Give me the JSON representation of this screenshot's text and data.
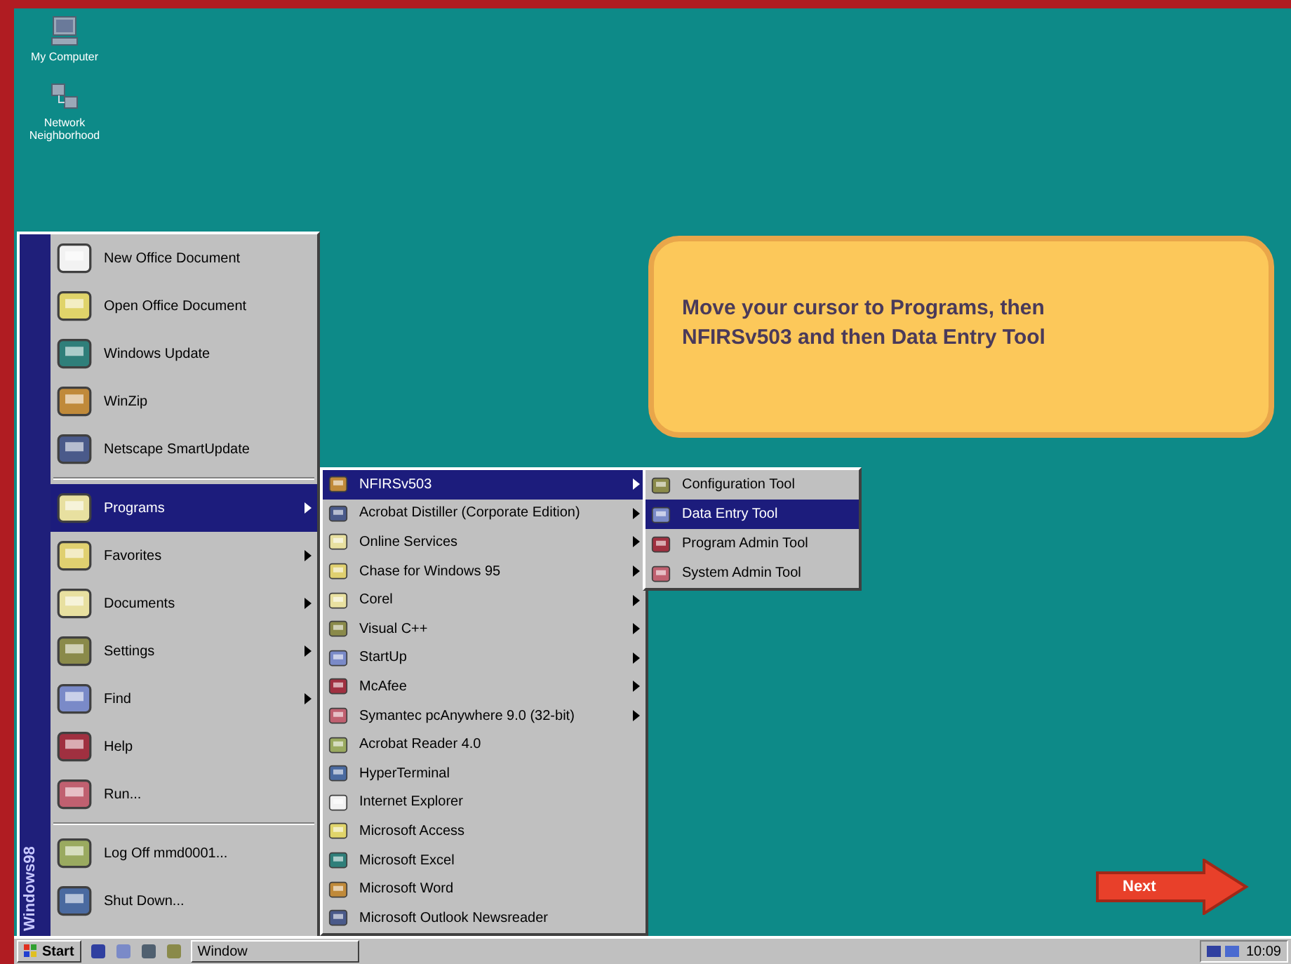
{
  "desktop_icons": [
    {
      "label": "My Computer"
    },
    {
      "label": "Network Neighborhood"
    }
  ],
  "callout": {
    "text": "Move your cursor to Programs, then NFIRSv503 and then Data Entry Tool"
  },
  "next_button": {
    "label": "Next"
  },
  "start_menu": {
    "banner": "Windows98",
    "items": [
      {
        "label": "New Office Document",
        "selected": false,
        "has_submenu": false
      },
      {
        "label": "Open Office Document",
        "selected": false,
        "has_submenu": false
      },
      {
        "label": "Windows Update",
        "selected": false,
        "has_submenu": false
      },
      {
        "label": "WinZip",
        "selected": false,
        "has_submenu": false
      },
      {
        "label": "Netscape SmartUpdate",
        "selected": false,
        "has_submenu": false,
        "separator_after": true
      },
      {
        "label": "Programs",
        "selected": true,
        "has_submenu": true
      },
      {
        "label": "Favorites",
        "selected": false,
        "has_submenu": true
      },
      {
        "label": "Documents",
        "selected": false,
        "has_submenu": true
      },
      {
        "label": "Settings",
        "selected": false,
        "has_submenu": true
      },
      {
        "label": "Find",
        "selected": false,
        "has_submenu": true
      },
      {
        "label": "Help",
        "selected": false,
        "has_submenu": false
      },
      {
        "label": "Run...",
        "selected": false,
        "has_submenu": false,
        "separator_after": true
      },
      {
        "label": "Log Off mmd0001...",
        "selected": false,
        "has_submenu": false
      },
      {
        "label": "Shut Down...",
        "selected": false,
        "has_submenu": false
      }
    ]
  },
  "programs_menu": {
    "items": [
      {
        "label": "NFIRSv503",
        "selected": true,
        "has_submenu": true
      },
      {
        "label": "Acrobat Distiller (Corporate Edition)",
        "selected": false,
        "has_submenu": true
      },
      {
        "label": "Online Services",
        "selected": false,
        "has_submenu": true
      },
      {
        "label": "Chase for Windows 95",
        "selected": false,
        "has_submenu": true
      },
      {
        "label": "Corel",
        "selected": false,
        "has_submenu": true
      },
      {
        "label": "Visual C++",
        "selected": false,
        "has_submenu": true
      },
      {
        "label": "StartUp",
        "selected": false,
        "has_submenu": true
      },
      {
        "label": "McAfee",
        "selected": false,
        "has_submenu": true
      },
      {
        "label": "Symantec pcAnywhere 9.0 (32-bit)",
        "selected": false,
        "has_submenu": true
      },
      {
        "label": "Acrobat Reader 4.0",
        "selected": false,
        "has_submenu": false
      },
      {
        "label": "HyperTerminal",
        "selected": false,
        "has_submenu": false
      },
      {
        "label": "Internet Explorer",
        "selected": false,
        "has_submenu": false
      },
      {
        "label": "Microsoft Access",
        "selected": false,
        "has_submenu": false
      },
      {
        "label": "Microsoft Excel",
        "selected": false,
        "has_submenu": false
      },
      {
        "label": "Microsoft Word",
        "selected": false,
        "has_submenu": false
      },
      {
        "label": "Microsoft Outlook Newsreader",
        "selected": false,
        "has_submenu": false
      }
    ]
  },
  "nfirs_menu": {
    "items": [
      {
        "label": "Configuration Tool",
        "selected": false
      },
      {
        "label": "Data Entry Tool",
        "selected": true
      },
      {
        "label": "Program Admin Tool",
        "selected": false
      },
      {
        "label": "System Admin Tool",
        "selected": false
      }
    ]
  },
  "taskbar": {
    "start_label": "Start",
    "tasks": [
      {
        "label": "Window"
      }
    ],
    "clock": "10:09"
  }
}
